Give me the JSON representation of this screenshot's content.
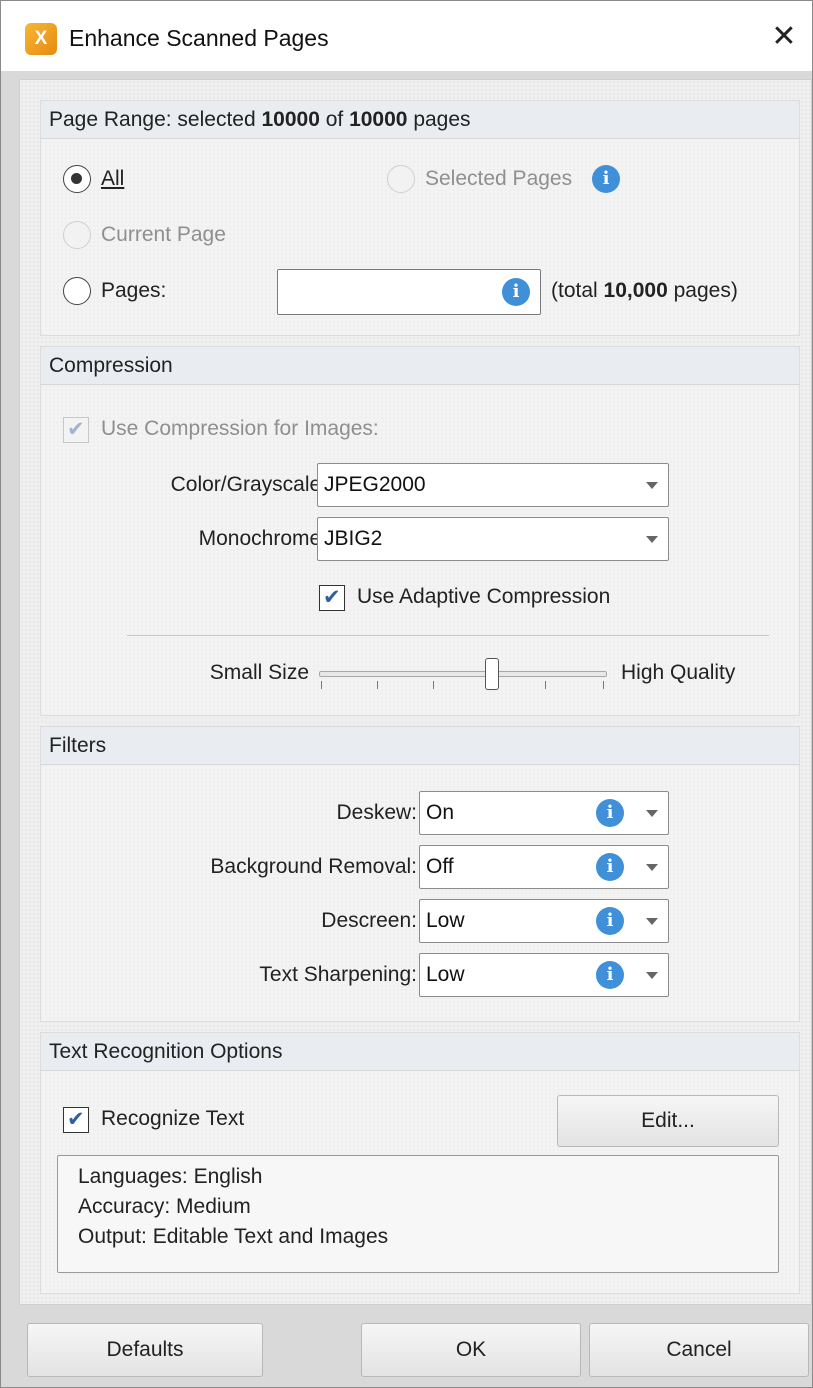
{
  "window": {
    "title": "Enhance Scanned Pages",
    "close_symbol": "✕",
    "app_icon": "pdf-xchange-icon",
    "app_icon_glyph": "X"
  },
  "page_range": {
    "header_prefix": "Page Range: selected ",
    "selected_count": "10000",
    "of_text": " of ",
    "total_count": "10000",
    "pages_suffix": " pages",
    "all_label": "All",
    "selected_pages_label": "Selected Pages",
    "current_page_label": "Current Page",
    "pages_label": "Pages:",
    "pages_value": "",
    "total_prefix": "(total ",
    "total_value": "10,000",
    "total_suffix": " pages)",
    "selected_option": "All"
  },
  "compression": {
    "header": "Compression",
    "use_compression_label": "Use Compression for Images:",
    "use_compression_checked": true,
    "color_label": "Color/Grayscale:",
    "color_value": "JPEG2000",
    "mono_label": "Monochrome:",
    "mono_value": "JBIG2",
    "adaptive_label": "Use Adaptive Compression",
    "adaptive_checked": true,
    "small_size_label": "Small Size",
    "high_quality_label": "High Quality",
    "slider_level": 0.6
  },
  "filters": {
    "header": "Filters",
    "items": [
      {
        "label": "Deskew:",
        "value": "On"
      },
      {
        "label": "Background Removal:",
        "value": "Off"
      },
      {
        "label": "Descreen:",
        "value": "Low"
      },
      {
        "label": "Text Sharpening:",
        "value": "Low"
      }
    ]
  },
  "text_recognition": {
    "header": "Text Recognition Options",
    "recognize_label": "Recognize Text",
    "recognize_checked": true,
    "edit_label": "Edit...",
    "summary": [
      "Languages: English",
      "Accuracy: Medium",
      "Output: Editable Text and Images"
    ]
  },
  "footer": {
    "defaults_label": "Defaults",
    "ok_label": "OK",
    "cancel_label": "Cancel"
  },
  "colors": {
    "info_blue": "#3f90d8",
    "check_blue": "#2f5f9f",
    "app_icon_orange": "#f0a020"
  }
}
